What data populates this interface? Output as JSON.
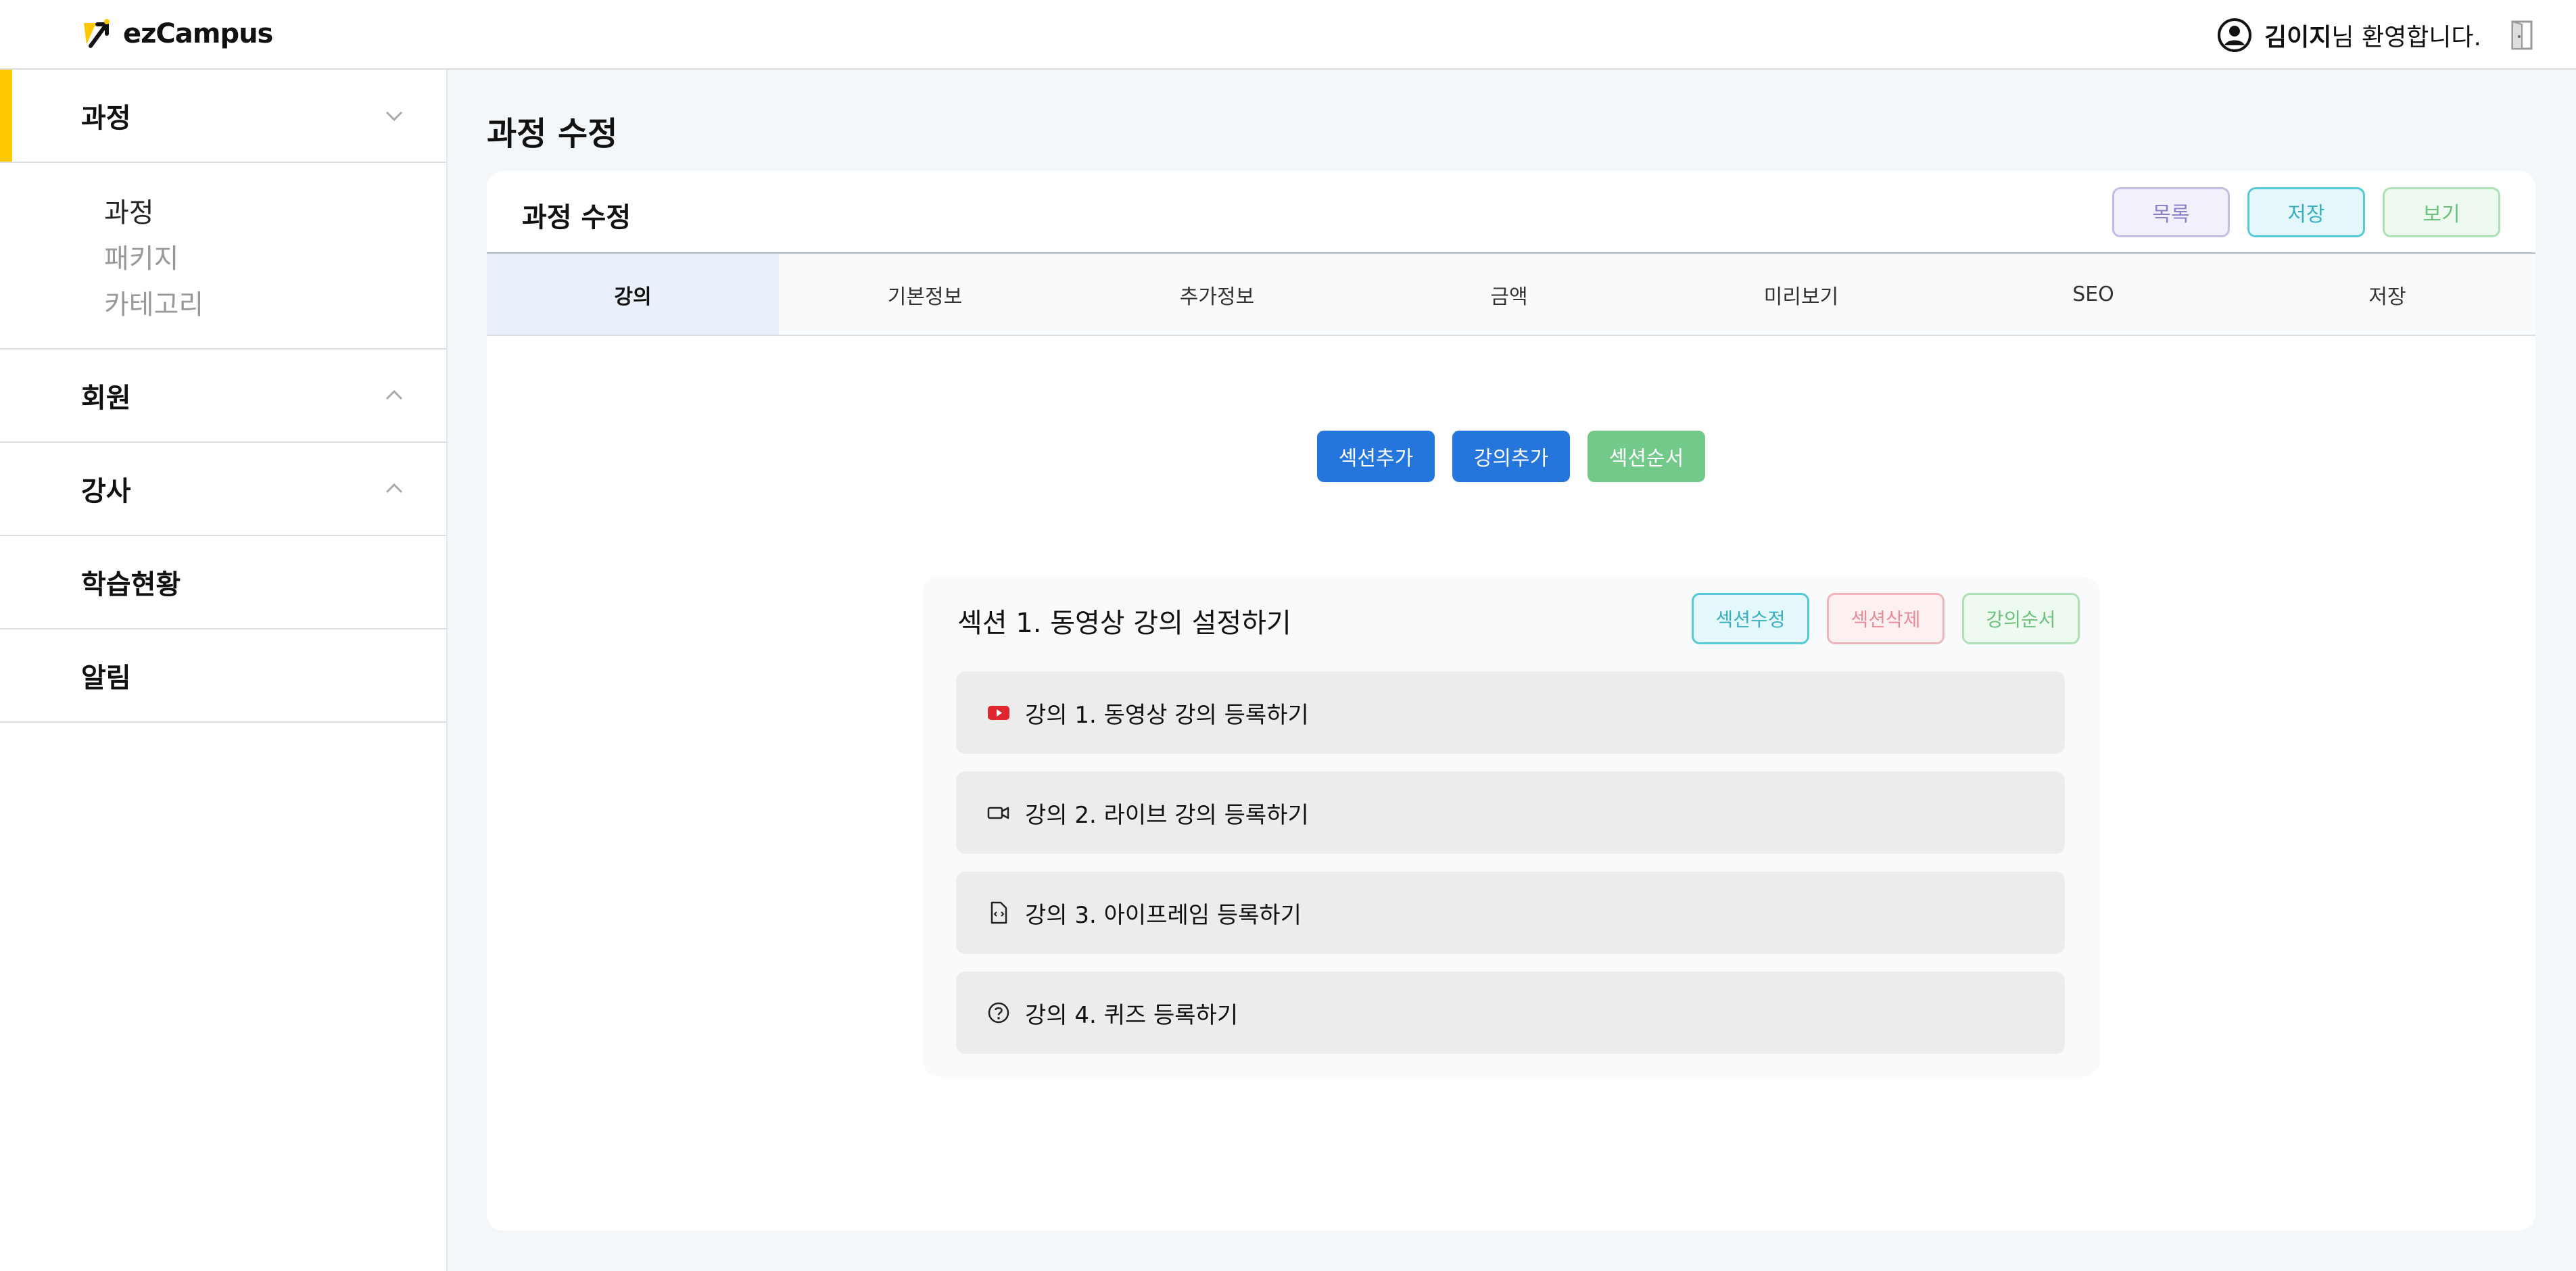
{
  "app": {
    "logo_text": "ezCampus"
  },
  "header": {
    "user_name": "김이지",
    "greeting": "님 환영합니다."
  },
  "sidebar": {
    "menus": [
      {
        "label": "과정",
        "expanded": true,
        "children": [
          "과정",
          "패키지",
          "카테고리"
        ],
        "selected_child": "과정"
      },
      {
        "label": "회원",
        "expanded": false
      },
      {
        "label": "강사",
        "expanded": false
      },
      {
        "label": "학습현황"
      },
      {
        "label": "알림"
      }
    ]
  },
  "main": {
    "page_title": "과정 수정",
    "card": {
      "title": "과정 수정",
      "buttons": {
        "list": "목록",
        "save": "저장",
        "view": "보기"
      },
      "tabs": [
        "강의",
        "기본정보",
        "추가정보",
        "금액",
        "미리보기",
        "SEO",
        "저장"
      ],
      "active_tab": "강의",
      "actions": {
        "add_section": "섹션추가",
        "add_lecture": "강의추가",
        "section_order": "섹션순서"
      },
      "section": {
        "title": "섹션 1. 동영상 강의 설정하기",
        "buttons": {
          "edit": "섹션수정",
          "delete": "섹션삭제",
          "lecture_order": "강의순서"
        },
        "lectures": [
          {
            "label": "강의 1. 동영상 강의 등록하기",
            "icon": "youtube-icon"
          },
          {
            "label": "강의 2. 라이브 강의 등록하기",
            "icon": "video-camera-icon"
          },
          {
            "label": "강의 3. 아이프레임 등록하기",
            "icon": "code-file-icon"
          },
          {
            "label": "강의 4. 퀴즈 등록하기",
            "icon": "question-circle-icon"
          }
        ]
      }
    }
  },
  "colors": {
    "brand_yellow": "#ffc800",
    "primary_blue": "#2475dc",
    "green": "#73c98a",
    "cyan": "#54cad8",
    "pink": "#f1b4bb",
    "lavender": "#c3bde6"
  }
}
